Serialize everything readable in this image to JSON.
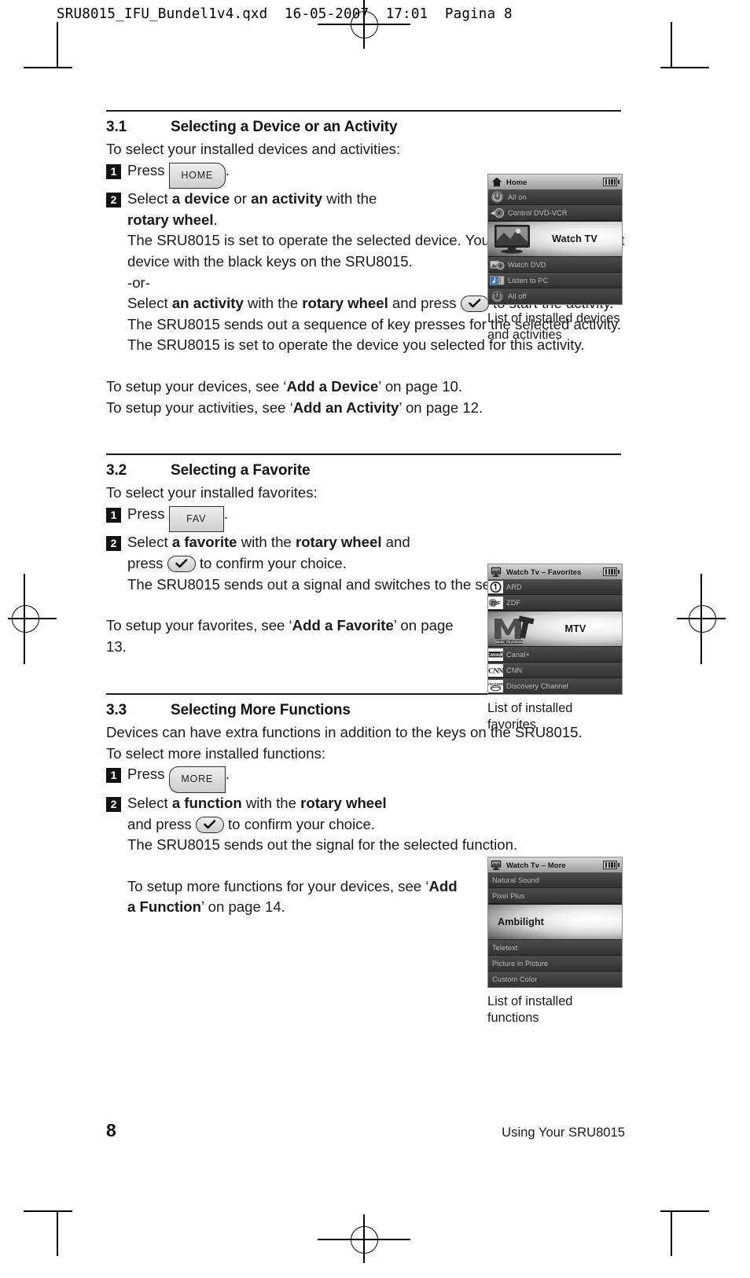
{
  "prepress": {
    "header": "SRU8015_IFU_Bundel1v4.qxd  16-05-2007  17:01  Pagina 8"
  },
  "sections": [
    {
      "number": "3.1",
      "title": "Selecting a Device or an Activity",
      "intro": "To select your installed devices and activities:",
      "step1_pre": "Press",
      "step1_key": "HOME",
      "step1_post": ".",
      "step2_line1_a": "Select ",
      "step2_line1_b": "a device",
      "step2_line1_c": " or ",
      "step2_line1_d": "an activity",
      "step2_line1_e": " with the",
      "step2_line2_b": "rotary wheel",
      "step2_line2_e": ".",
      "cont1": "The SRU8015 is set to operate the selected device. You can now control that device with the black keys on the SRU8015.",
      "cont2": "-or-",
      "cont3_a": "Select ",
      "cont3_b": "an activity",
      "cont3_c": " with the ",
      "cont3_d": "rotary wheel",
      "cont3_e": " and press",
      "cont3_f": "to start the activity.",
      "cont4": "The SRU8015 sends out a sequence of key presses for the selected activity. The SRU8015 is set to operate the device you selected for this activity.",
      "after1_a": "To setup your devices, see ‘",
      "after1_b": "Add a Device",
      "after1_c": "’ on page 10.",
      "after2_a": "To setup your activities, see ‘",
      "after2_b": "Add an Activity",
      "after2_c": "’ on page 12."
    },
    {
      "number": "3.2",
      "title": "Selecting a Favorite",
      "intro": "To select your installed favorites:",
      "step1_pre": "Press",
      "step1_key": "FAV",
      "step1_post": ".",
      "step2_a": "Select ",
      "step2_b": "a favorite",
      "step2_c": " with the ",
      "step2_d": "rotary wheel",
      "step2_e": " and",
      "step2_f": "press",
      "step2_g": "to confirm your choice.",
      "cont1": "The SRU8015 sends out a signal and switches to the selected channel.",
      "after1_a": "To setup your favorites, see ‘",
      "after1_b": "Add a Favorite",
      "after1_c": "’ on page 13."
    },
    {
      "number": "3.3",
      "title": "Selecting More Functions",
      "lead": "Devices can have extra functions in addition to the keys on the SRU8015.",
      "intro": "To select more installed functions:",
      "step1_pre": "Press",
      "step1_key": "MORE",
      "step1_post": ".",
      "step2_a": "Select ",
      "step2_b": "a function",
      "step2_c": " with the ",
      "step2_d": "rotary wheel",
      "step2_e": "and press",
      "step2_f": "to confirm your choice.",
      "cont1": "The SRU8015 sends out the signal for the selected function.",
      "after1_a": "To setup more functions for your devices, see ‘",
      "after1_b": "Add a Function",
      "after1_c": "’ on page 14."
    }
  ],
  "screens": [
    {
      "id": "home",
      "title": "Home",
      "title_icon": "home-icon",
      "battery": "battery-full-icon",
      "caption": "List of installed devices and activities",
      "items": [
        {
          "label": "All on",
          "icon": "power-on-icon",
          "selected": false
        },
        {
          "label": "Control DVD-VCR",
          "icon": "disc-icon",
          "selected": false
        },
        {
          "label": "Watch TV",
          "icon": "television-icon",
          "selected": true
        },
        {
          "label": "Watch DVD",
          "icon": "dvd-player-icon",
          "selected": false
        },
        {
          "label": "Listen to PC",
          "icon": "pc-music-icon",
          "selected": false
        },
        {
          "label": "All off",
          "icon": "power-off-icon",
          "selected": false
        }
      ]
    },
    {
      "id": "favorites",
      "title": "Watch Tv – Favorites",
      "title_icon": "television-icon",
      "battery": "battery-full-icon",
      "caption": "List of installed favorites",
      "items": [
        {
          "label": "ARD",
          "icon": "ard-logo-icon",
          "logo": "1",
          "selected": false
        },
        {
          "label": "ZDF",
          "icon": "zdf-logo-icon",
          "logo": "ZDF",
          "selected": false
        },
        {
          "label": "MTV",
          "icon": "mtv-logo-icon",
          "logo": "MTV",
          "selected": true
        },
        {
          "label": "Canal+",
          "icon": "canalplus-logo-icon",
          "logo": "CANAL+",
          "selected": false
        },
        {
          "label": "CNN",
          "icon": "cnn-logo-icon",
          "logo": "CNN",
          "selected": false
        },
        {
          "label": "Discovery Channel",
          "icon": "discovery-logo-icon",
          "logo": "DISCOVERY",
          "selected": false
        }
      ]
    },
    {
      "id": "more",
      "title": "Watch Tv – More",
      "title_icon": "television-icon",
      "battery": "battery-full-icon",
      "caption": "List of installed functions",
      "items": [
        {
          "label": "Natural Sound",
          "selected": false
        },
        {
          "label": "Pixel Plus",
          "selected": false
        },
        {
          "label": "Ambilight",
          "selected": true
        },
        {
          "label": "Teletext",
          "selected": false
        },
        {
          "label": "Picture in Picture",
          "selected": false
        },
        {
          "label": "Custom Color",
          "selected": false
        }
      ]
    }
  ],
  "footer": {
    "page_number": "8",
    "running_head": "Using Your SRU8015"
  }
}
